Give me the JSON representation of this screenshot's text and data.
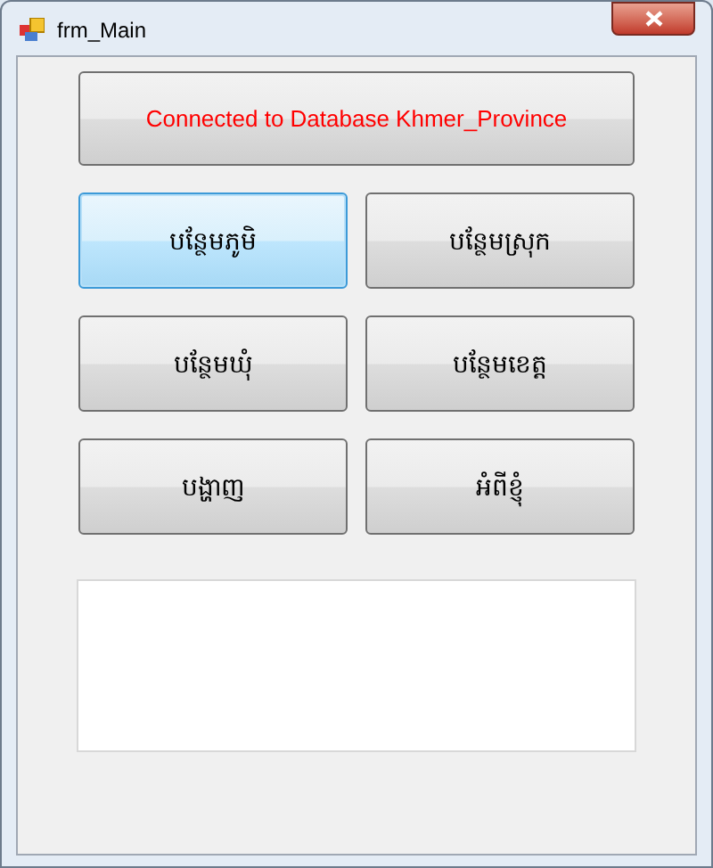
{
  "window": {
    "title": "frm_Main"
  },
  "status_button": {
    "label": "Connected to Database Khmer_Province"
  },
  "buttons": [
    {
      "label": "បន្ថែមភូមិ",
      "focused": true
    },
    {
      "label": "បន្ថែមស្រុក",
      "focused": false
    },
    {
      "label": "បន្ថែមឃុំ",
      "focused": false
    },
    {
      "label": "បន្ថែមខេត្ត",
      "focused": false
    },
    {
      "label": "បង្ហាញ",
      "focused": false
    },
    {
      "label": "អំពីខ្ញុំ",
      "focused": false
    }
  ]
}
